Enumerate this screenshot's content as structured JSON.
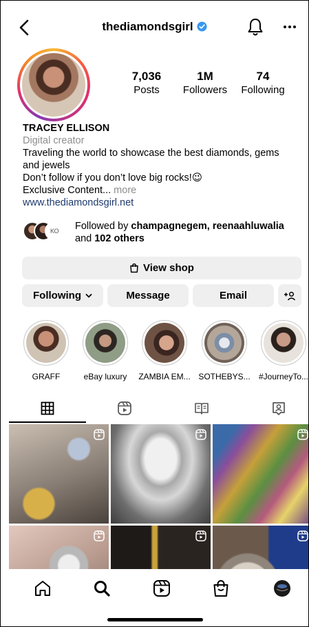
{
  "header": {
    "username": "thediamondsgirl"
  },
  "profile": {
    "stats": [
      {
        "value": "7,036",
        "label": "Posts"
      },
      {
        "value": "1M",
        "label": "Followers"
      },
      {
        "value": "74",
        "label": "Following"
      }
    ],
    "name": "TRACEY ELLISON",
    "category": "Digital creator",
    "bio_line1": "Traveling the world to showcase the best diamonds, gems and jewels",
    "bio_line2": "Don’t follow if you don’t love big rocks!😉",
    "bio_line3": "Exclusive Content...",
    "bio_more": " more",
    "website": "www.thediamondsgirl.net",
    "followed_prefix": "Followed by ",
    "followed_names": "champagnegem, reenaahluwalia",
    "followed_and": "and ",
    "followed_count": "102 others"
  },
  "buttons": {
    "view_shop": "View shop",
    "following": "Following",
    "message": "Message",
    "email": "Email"
  },
  "highlights": [
    {
      "label": "GRAFF"
    },
    {
      "label": "eBay luxury"
    },
    {
      "label": "ZAMBIA EM..."
    },
    {
      "label": "SOTHEBYS..."
    },
    {
      "label": "#JourneyTo..."
    }
  ],
  "tabs": [
    "grid-icon",
    "reels-icon",
    "guide-icon",
    "tagged-icon"
  ],
  "nav": [
    "home-icon",
    "search-icon",
    "reels-icon",
    "shop-icon",
    "profile-avatar"
  ],
  "colors": {
    "verified": "#3897f0",
    "link": "#1f3a6e",
    "button_bg": "#efefef",
    "muted": "#8e8e8e"
  }
}
